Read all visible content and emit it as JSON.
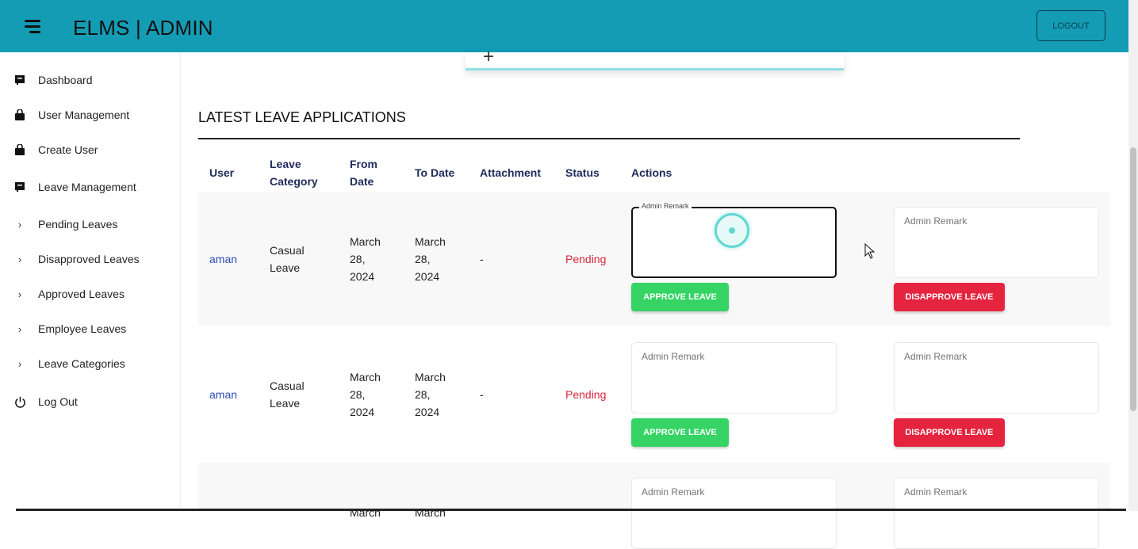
{
  "header": {
    "brand": "ELMS | ADMIN",
    "logout_label": "LOGOUT"
  },
  "sidebar": {
    "items": [
      {
        "label": "Dashboard",
        "icon": "dashboard-icon"
      },
      {
        "label": "User Management",
        "icon": "bag-icon"
      },
      {
        "label": "Create User",
        "icon": "bag-icon"
      },
      {
        "label": "Leave Management",
        "icon": "dashboard-icon"
      },
      {
        "label": "Pending Leaves",
        "icon": "chevron-right-icon"
      },
      {
        "label": "Disapproved Leaves",
        "icon": "chevron-right-icon"
      },
      {
        "label": "Approved Leaves",
        "icon": "chevron-right-icon"
      },
      {
        "label": "Employee Leaves",
        "icon": "chevron-right-icon"
      },
      {
        "label": "Leave Categories",
        "icon": "chevron-right-icon"
      },
      {
        "label": "Log Out",
        "icon": "power-icon"
      }
    ]
  },
  "main": {
    "card_glyph": "+",
    "section_title": "LATEST LEAVE APPLICATIONS",
    "columns": {
      "user": "User",
      "category_1": "Leave",
      "category_2": "Category",
      "from_1": "From",
      "from_2": "Date",
      "to": "To Date",
      "attachment": "Attachment",
      "status": "Status",
      "actions": "Actions"
    },
    "rows": [
      {
        "user": "aman",
        "category_1": "Casual",
        "category_2": "Leave",
        "from_1": "March",
        "from_2": "28,",
        "from_3": "2024",
        "to_1": "March",
        "to_2": "28,",
        "to_3": "2024",
        "attachment": "-",
        "status": "Pending"
      },
      {
        "user": "aman",
        "category_1": "Casual",
        "category_2": "Leave",
        "from_1": "March",
        "from_2": "28,",
        "from_3": "2024",
        "to_1": "March",
        "to_2": "28,",
        "to_3": "2024",
        "attachment": "-",
        "status": "Pending"
      },
      {
        "from_1": "March",
        "to_1": "March"
      }
    ],
    "remark_placeholder": "Admin Remark",
    "remark_float_label": "Admin Remark",
    "approve_label": "APPROVE LEAVE",
    "disapprove_label": "DISAPPROVE LEAVE"
  },
  "colors": {
    "header_bg": "#149cb4",
    "approve": "#35d465",
    "disapprove": "#e5243f",
    "status_pending": "#d9263b",
    "link": "#2b4db8"
  }
}
